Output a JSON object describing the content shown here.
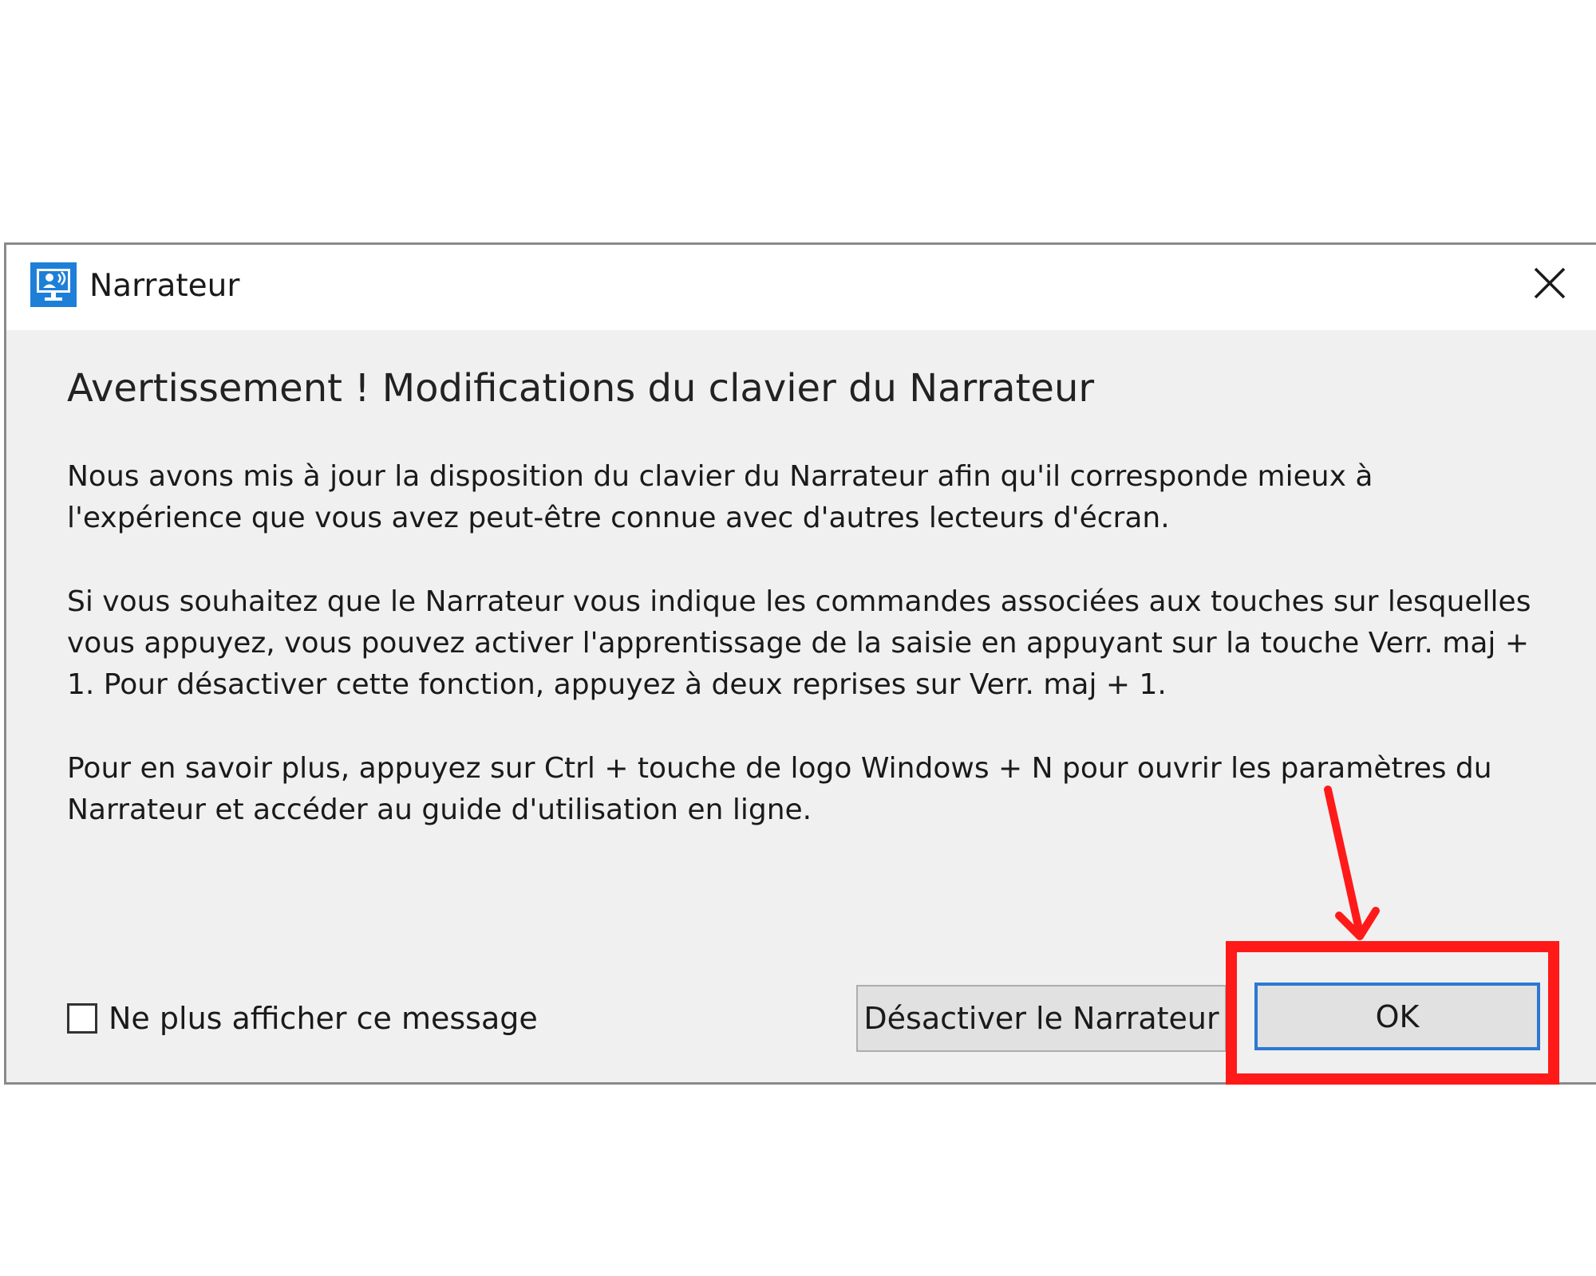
{
  "window": {
    "title": "Narrateur",
    "close_icon": "close-icon",
    "app_icon": "narrator-app-icon"
  },
  "dialog": {
    "heading": "Avertissement ! Modifications du clavier du Narrateur",
    "paragraphs": [
      "Nous avons mis à jour la disposition du clavier du Narrateur afin qu'il corresponde mieux à l'expérience que vous avez peut-être connue avec d'autres lecteurs d'écran.",
      "Si vous souhaitez que le Narrateur vous indique les commandes associées aux touches sur lesquelles vous appuyez, vous pouvez activer l'apprentissage de la saisie en appuyant sur la touche Verr. maj + 1. Pour désactiver cette fonction, appuyez à deux reprises sur Verr. maj + 1.",
      "Pour en savoir plus, appuyez sur Ctrl + touche de logo Windows + N pour ouvrir les paramètres du Narrateur et accéder au guide d'utilisation en ligne."
    ],
    "checkbox": {
      "label": "Ne plus afficher ce message",
      "checked": false
    },
    "buttons": {
      "disable_label": "Désactiver le Narrateur",
      "ok_label": "OK"
    }
  },
  "colors": {
    "annotation": "#ff1a1a",
    "focus_border": "#2c78d2",
    "dialog_bg": "#f0f0f0"
  }
}
